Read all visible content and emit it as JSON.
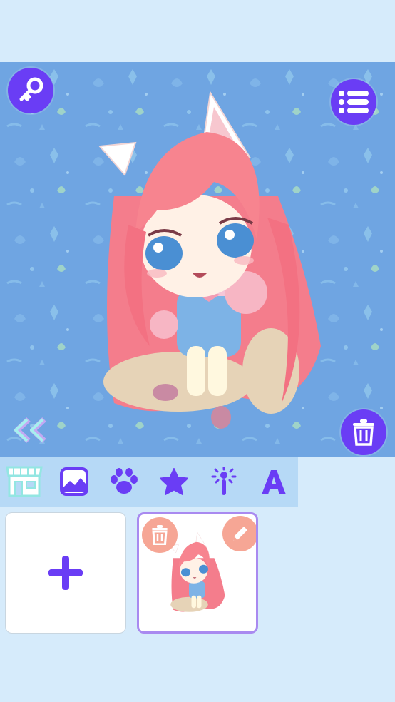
{
  "app": {
    "colors": {
      "accent": "#6a3df5",
      "canvas_bg": "#6fa5e2",
      "toolbar_bg": "#b6d9f6",
      "page_bg": "#d6ebfb",
      "selected_border": "#a98af0",
      "slot_action": "#f6a695"
    }
  },
  "canvas": {
    "buttons": {
      "key": "key-icon",
      "menu": "list-icon",
      "trash": "trash-icon",
      "back": "double-chevron-left-icon"
    }
  },
  "toolbar": {
    "tools": [
      {
        "icon": "shop-icon"
      },
      {
        "icon": "background-image-icon"
      },
      {
        "icon": "paw-icon"
      },
      {
        "icon": "star-icon"
      },
      {
        "icon": "magic-wand-icon"
      },
      {
        "icon": "text-icon"
      }
    ]
  },
  "gallery": {
    "new_slot_icon": "plus-icon",
    "saved_slot": {
      "delete_icon": "trash-icon",
      "edit_icon": "pencil-icon"
    }
  }
}
